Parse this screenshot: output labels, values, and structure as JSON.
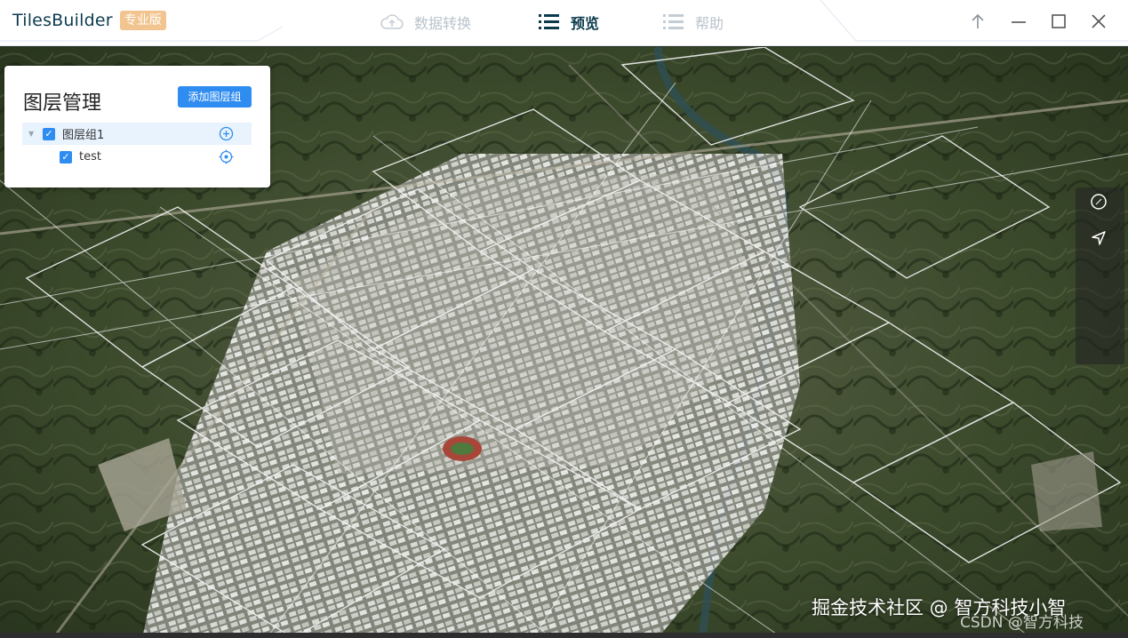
{
  "app": {
    "name": "TilesBuilder",
    "edition_badge": "专业版"
  },
  "nav": {
    "items": [
      {
        "label": "数据转换",
        "icon": "cloud-icon",
        "state": "inactive"
      },
      {
        "label": "预览",
        "icon": "list-icon",
        "state": "active"
      },
      {
        "label": "帮助",
        "icon": "list-icon",
        "state": "inactive"
      }
    ]
  },
  "window_controls": {
    "icons": [
      "pin-up-icon",
      "minimize-icon",
      "maximize-icon",
      "close-icon"
    ]
  },
  "layer_panel": {
    "title": "图层管理",
    "add_group_button": "添加图层组",
    "tree": [
      {
        "label": "图层组1",
        "checked": true,
        "expanded": true,
        "action_icon": "add-circle-icon"
      },
      {
        "label": "test",
        "checked": true,
        "action_icon": "locate-icon"
      }
    ]
  },
  "right_toolbar": {
    "icons": [
      "compass-icon",
      "navigate-icon"
    ]
  },
  "watermark": {
    "line1": "掘金技术社区 @ 智方科技小智",
    "line2": "CSDN @智方科技"
  },
  "colors": {
    "accent": "#2f8cf0",
    "brand_badge": "#f2c48f",
    "nav_active": "#0b3a4d",
    "nav_inactive": "#b9c3cc"
  }
}
